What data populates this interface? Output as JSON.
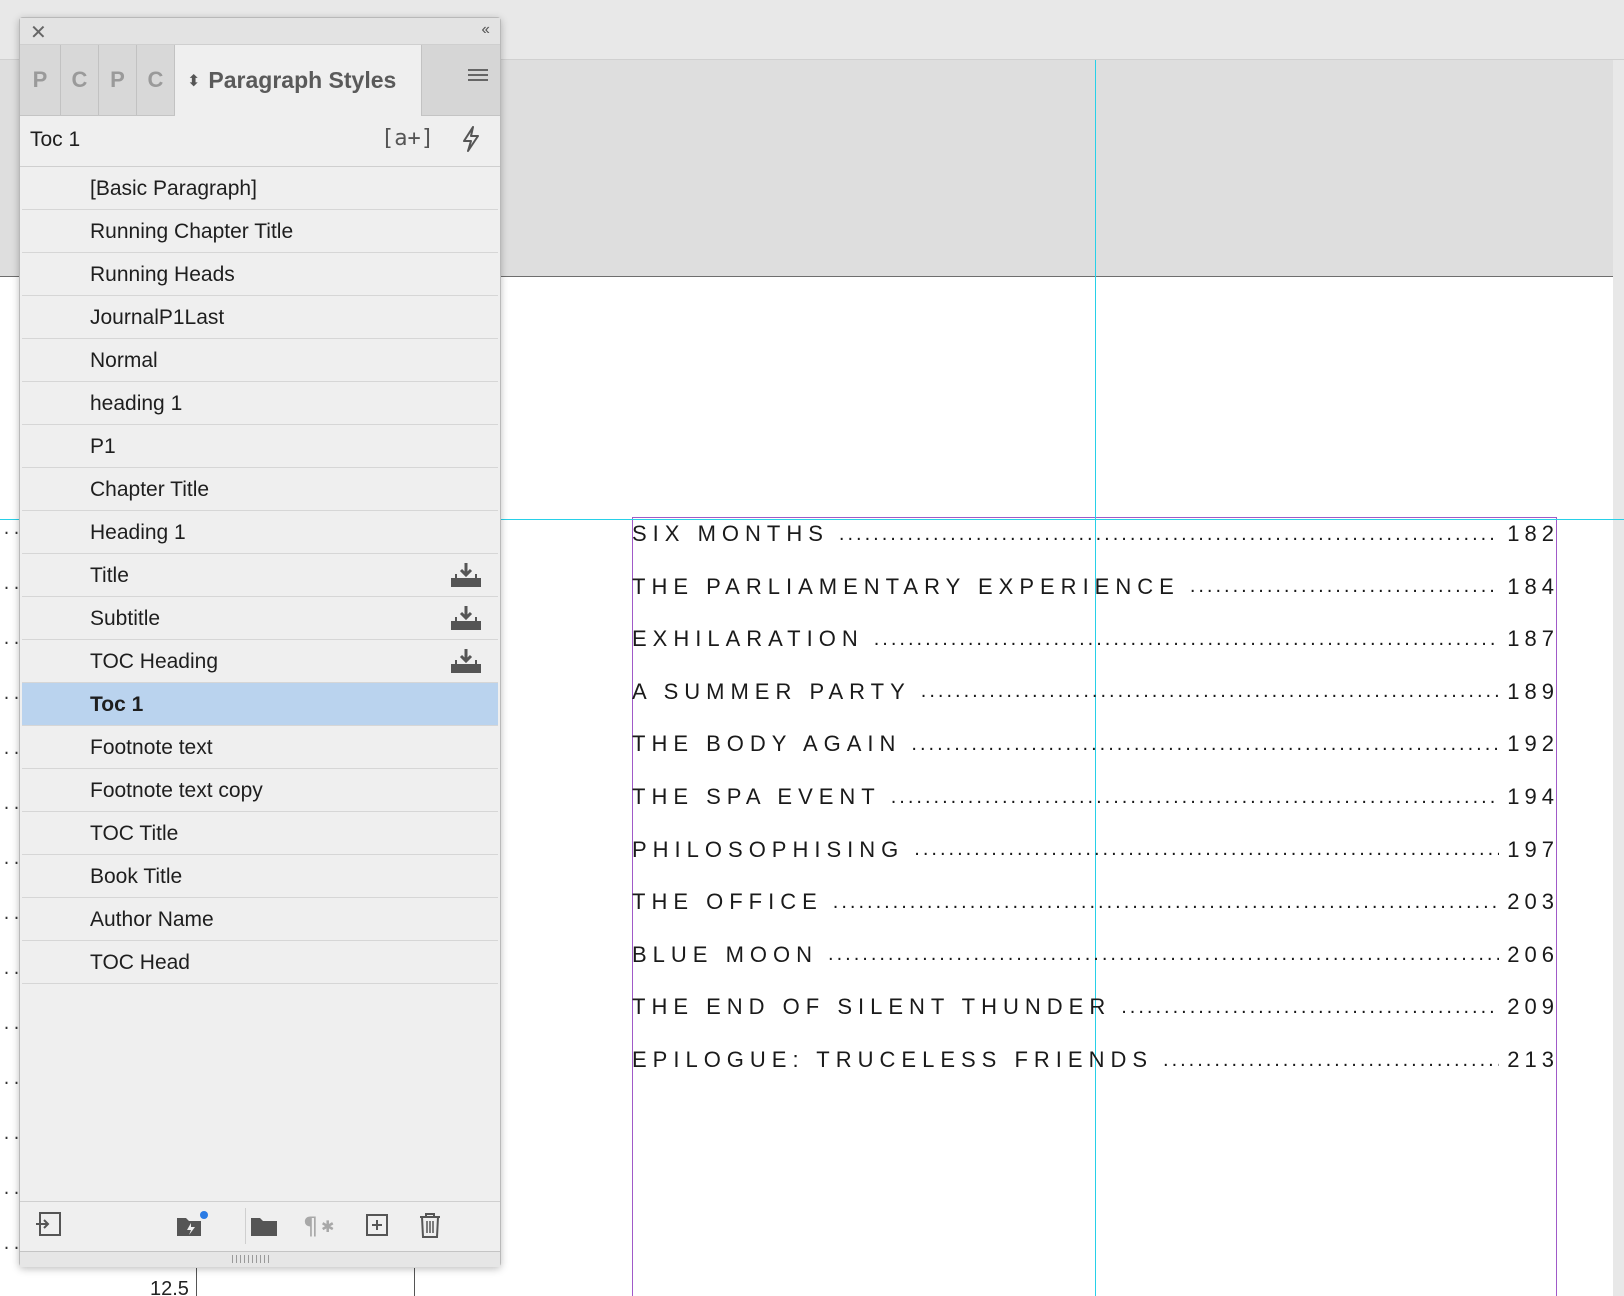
{
  "panel": {
    "tabs": [
      "P",
      "C",
      "P",
      "C"
    ],
    "active_tab": "Paragraph Styles",
    "current_style": "Toc 1",
    "new_style_icon_text": "[a+]",
    "styles": [
      {
        "label": "[Basic Paragraph]",
        "imported": false,
        "selected": false
      },
      {
        "label": "Running Chapter Title",
        "imported": false,
        "selected": false
      },
      {
        "label": "Running Heads",
        "imported": false,
        "selected": false
      },
      {
        "label": "JournalP1Last",
        "imported": false,
        "selected": false
      },
      {
        "label": "Normal",
        "imported": false,
        "selected": false
      },
      {
        "label": "heading 1",
        "imported": false,
        "selected": false
      },
      {
        "label": "P1",
        "imported": false,
        "selected": false
      },
      {
        "label": "Chapter Title",
        "imported": false,
        "selected": false
      },
      {
        "label": "Heading 1",
        "imported": false,
        "selected": false
      },
      {
        "label": "Title",
        "imported": true,
        "selected": false
      },
      {
        "label": "Subtitle",
        "imported": true,
        "selected": false
      },
      {
        "label": "TOC Heading",
        "imported": true,
        "selected": false
      },
      {
        "label": "Toc 1",
        "imported": false,
        "selected": true
      },
      {
        "label": "Footnote text",
        "imported": false,
        "selected": false
      },
      {
        "label": "Footnote text copy",
        "imported": false,
        "selected": false
      },
      {
        "label": "TOC Title",
        "imported": false,
        "selected": false
      },
      {
        "label": "Book Title",
        "imported": false,
        "selected": false
      },
      {
        "label": "Author Name",
        "imported": false,
        "selected": false
      },
      {
        "label": "TOC Head",
        "imported": false,
        "selected": false
      }
    ]
  },
  "toc_entries": [
    {
      "title": "SIX MONTHS",
      "page": "182"
    },
    {
      "title": "THE PARLIAMENTARY EXPERIENCE",
      "page": "184"
    },
    {
      "title": "EXHILARATION",
      "page": "187"
    },
    {
      "title": "A SUMMER PARTY",
      "page": "189"
    },
    {
      "title": "THE BODY AGAIN",
      "page": "192"
    },
    {
      "title": "THE SPA EVENT",
      "page": "194"
    },
    {
      "title": "PHILOSOPHISING",
      "page": "197"
    },
    {
      "title": "THE OFFICE",
      "page": "203"
    },
    {
      "title": "BLUE MOON",
      "page": "206"
    },
    {
      "title": "THE END OF SILENT THUNDER",
      "page": "209"
    },
    {
      "title": "EPILOGUE: TRUCELESS FRIENDS",
      "page": "213"
    }
  ],
  "ruler_value": "12.5",
  "colors": {
    "guide": "#27d0e8",
    "margin": "#a05ac8",
    "selection": "#bad3ee"
  }
}
